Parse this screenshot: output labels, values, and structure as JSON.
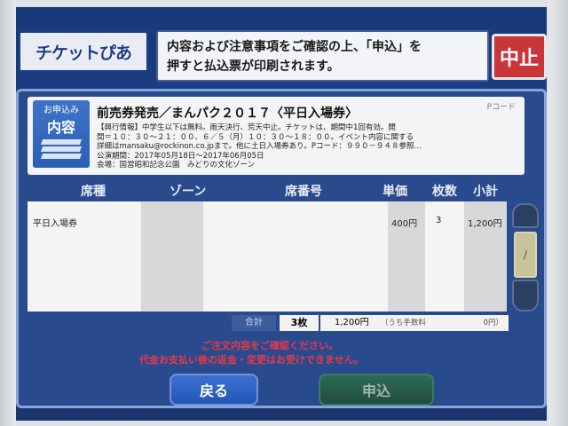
{
  "header": {
    "logo_text": "チケットぴあ",
    "instruction_line1": "内容および注意事項をご確認の上、「申込」を",
    "instruction_line2": "押すと払込票が印刷されます。",
    "cancel_label": "中止"
  },
  "event": {
    "icon_small": "お申込み",
    "icon_big": "内容",
    "title": "前売券発売／まんパク２０１７〈平日入場券〉",
    "pcode_label": "Pコード",
    "info_lines": [
      "【興行情報】中学生以下は無料。雨天決行、荒天中止。チケットは、期間中1回有効。開",
      "間＝１０：３０～２１：００、６／５（月）１０：３０～１８：００。イベント内容に関する",
      "詳細はmansaku@rockinon.co.jpまで。他に土日入場券あり。Pコード：９９０－９４８参照…",
      "公演期間：2017年05月18日～2017年06月05日",
      "会場：国営昭和記念公園　みどりの文化ゾーン"
    ]
  },
  "table": {
    "headers": [
      "席種",
      "ゾーン",
      "席番号",
      "単価",
      "枚数",
      "小計"
    ],
    "rows": [
      {
        "seat_type": "平日入場券",
        "zone": "",
        "seat_no": "",
        "unit_price": "400円",
        "count": "3",
        "subtotal": "1,200円"
      }
    ]
  },
  "totals": {
    "label": "合計",
    "count": "3枚",
    "amount": "1,200円",
    "fee_label": "（うち手数料",
    "fee_value": "0円）"
  },
  "warning": {
    "line1": "ご注文内容をご確認ください。",
    "line2": "代金お支払い後の返金・変更はお受けできません。"
  },
  "footer": {
    "back_label": "戻る",
    "apply_label": "申込"
  },
  "colors": {
    "screen_bg": "#1d3f86",
    "cancel": "#c9363a",
    "warning": "#e4394a",
    "back": "#2456b8",
    "apply": "#214d40"
  }
}
